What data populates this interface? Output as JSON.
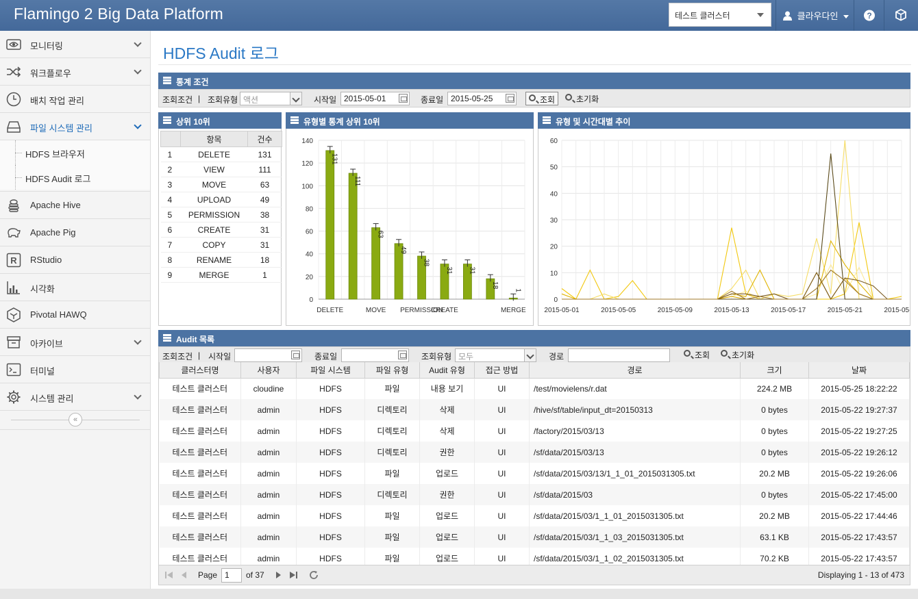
{
  "header": {
    "title": "Flamingo 2 Big Data Platform",
    "cluster": "테스트 클러스터",
    "user": "클라우다인"
  },
  "sidebar": {
    "items": [
      {
        "label": "모니터링"
      },
      {
        "label": "워크플로우"
      },
      {
        "label": "배치 작업 관리"
      },
      {
        "label": "파일 시스템 관리"
      },
      {
        "label": "Apache Hive"
      },
      {
        "label": "Apache Pig"
      },
      {
        "label": "RStudio"
      },
      {
        "label": "시각화"
      },
      {
        "label": "Pivotal HAWQ"
      },
      {
        "label": "아카이브"
      },
      {
        "label": "터미널"
      },
      {
        "label": "시스템 관리"
      }
    ],
    "sub_items": [
      {
        "label": "HDFS 브라우저"
      },
      {
        "label": "HDFS Audit 로그"
      }
    ]
  },
  "page": {
    "title": "HDFS Audit 로그"
  },
  "stats": {
    "header": "통계 조건",
    "condition_label": "조회조건",
    "sep": "|",
    "type_label": "조회유형",
    "type_value": "액션",
    "start_label": "시작일",
    "start_value": "2015-05-01",
    "end_label": "종료일",
    "end_value": "2015-05-25",
    "search": "조회",
    "reset": "초기화"
  },
  "top10": {
    "header": "상위 10위",
    "col_item": "항목",
    "col_count": "건수",
    "rows": [
      {
        "rank": "1",
        "item": "DELETE",
        "count": "131"
      },
      {
        "rank": "2",
        "item": "VIEW",
        "count": "111"
      },
      {
        "rank": "3",
        "item": "MOVE",
        "count": "63"
      },
      {
        "rank": "4",
        "item": "UPLOAD",
        "count": "49"
      },
      {
        "rank": "5",
        "item": "PERMISSION",
        "count": "38"
      },
      {
        "rank": "6",
        "item": "CREATE",
        "count": "31"
      },
      {
        "rank": "7",
        "item": "COPY",
        "count": "31"
      },
      {
        "rank": "8",
        "item": "RENAME",
        "count": "18"
      },
      {
        "rank": "9",
        "item": "MERGE",
        "count": "1"
      }
    ]
  },
  "bar_panel": {
    "header": "유형별 통계 상위 10위"
  },
  "line_panel": {
    "header": "유형 및 시간대별 추이"
  },
  "chart_data": [
    {
      "type": "bar",
      "categories": [
        "DELETE",
        "VIEW",
        "MOVE",
        "UPLOAD",
        "PERMISSION",
        "CREATE",
        "COPY",
        "RENAME",
        "MERGE"
      ],
      "tick_labels": [
        "DELETE",
        "MOVE",
        "PERMISSION",
        "CREATE",
        "MERGE"
      ],
      "values": [
        131,
        111,
        63,
        49,
        38,
        31,
        31,
        18,
        1
      ],
      "ylim": [
        0,
        140
      ],
      "yticks": [
        0,
        20,
        40,
        60,
        80,
        100,
        120,
        140
      ],
      "color": "#8aaa12",
      "grid": true
    },
    {
      "type": "line",
      "x": [
        "2015-05-01",
        "2015-05-02",
        "2015-05-03",
        "2015-05-04",
        "2015-05-05",
        "2015-05-06",
        "2015-05-07",
        "2015-05-08",
        "2015-05-09",
        "2015-05-10",
        "2015-05-11",
        "2015-05-12",
        "2015-05-13",
        "2015-05-14",
        "2015-05-15",
        "2015-05-16",
        "2015-05-17",
        "2015-05-18",
        "2015-05-19",
        "2015-05-20",
        "2015-05-21",
        "2015-05-22",
        "2015-05-23",
        "2015-05-24",
        "2015-05-25"
      ],
      "xticks": [
        "2015-05-01",
        "2015-05-05",
        "2015-05-09",
        "2015-05-13",
        "2015-05-17",
        "2015-05-21",
        "2015-05-25"
      ],
      "ylim": [
        0,
        60
      ],
      "yticks": [
        0,
        10,
        20,
        30,
        40,
        50,
        60
      ],
      "grid": true,
      "series": [
        {
          "color": "#f2c80f",
          "values": [
            4,
            0,
            11,
            0,
            1,
            7,
            0,
            0,
            0,
            0,
            0,
            0,
            27,
            2,
            0,
            0,
            0,
            0,
            0,
            0,
            2,
            29,
            0,
            0,
            1
          ]
        },
        {
          "color": "#f6dd66",
          "values": [
            0,
            0,
            0,
            2,
            0,
            0,
            0,
            0,
            0,
            0,
            0,
            0,
            4,
            11,
            0,
            2,
            1,
            2,
            23,
            2,
            60,
            0,
            0,
            0,
            0
          ]
        },
        {
          "color": "#e0b400",
          "values": [
            2,
            0,
            0,
            0,
            0,
            0,
            0,
            0,
            0,
            0,
            0,
            0,
            2,
            1,
            11,
            0,
            0,
            0,
            0,
            22,
            13,
            6,
            0,
            0,
            0
          ]
        },
        {
          "color": "#fbe99a",
          "values": [
            0,
            0,
            0,
            0,
            0,
            0,
            0,
            0,
            0,
            0,
            0,
            0,
            1,
            3,
            0,
            0,
            0,
            0,
            2,
            13,
            2,
            12,
            0,
            0,
            0
          ]
        },
        {
          "color": "#d9a800",
          "values": [
            0,
            0,
            0,
            0,
            0,
            0,
            0,
            0,
            0,
            0,
            0,
            0,
            1,
            0,
            0,
            0,
            0,
            0,
            10,
            0,
            8,
            2,
            0,
            0,
            0
          ]
        },
        {
          "color": "#5a4a1a",
          "values": [
            0,
            0,
            0,
            0,
            0,
            0,
            0,
            0,
            0,
            0,
            0,
            0,
            0,
            0,
            0,
            0,
            0,
            0,
            0,
            55,
            0,
            0,
            0,
            0,
            0
          ]
        },
        {
          "color": "#7a5a20",
          "values": [
            0,
            0,
            0,
            0,
            0,
            0,
            0,
            0,
            0,
            0,
            0,
            0,
            2,
            2,
            1,
            2,
            0,
            0,
            10,
            0,
            8,
            7,
            5,
            0,
            0
          ]
        },
        {
          "color": "#a07a2a",
          "values": [
            0,
            0,
            0,
            0,
            0,
            0,
            0,
            0,
            0,
            0,
            0,
            0,
            3,
            0,
            1,
            0,
            0,
            0,
            4,
            11,
            7,
            2,
            0,
            0,
            0
          ]
        }
      ]
    }
  ],
  "audit": {
    "header": "Audit 목록",
    "condition_label": "조회조건",
    "sep": "|",
    "start_label": "시작일",
    "end_label": "종료일",
    "type_label": "조회유형",
    "type_value": "모두",
    "path_label": "경로",
    "search": "조회",
    "reset": "초기화",
    "columns": [
      "클러스터명",
      "사용자",
      "파일 시스템",
      "파일 유형",
      "Audit 유형",
      "접근 방법",
      "경로",
      "크기",
      "날짜"
    ],
    "rows": [
      [
        "테스트 클러스터",
        "cloudine",
        "HDFS",
        "파일",
        "내용 보기",
        "UI",
        "/test/movielens/r.dat",
        "224.2 MB",
        "2015-05-25 18:22:22"
      ],
      [
        "테스트 클러스터",
        "admin",
        "HDFS",
        "디렉토리",
        "삭제",
        "UI",
        "/hive/sf/table/input_dt=20150313",
        "0 bytes",
        "2015-05-22 19:27:37"
      ],
      [
        "테스트 클러스터",
        "admin",
        "HDFS",
        "디렉토리",
        "삭제",
        "UI",
        "/factory/2015/03/13",
        "0 bytes",
        "2015-05-22 19:27:25"
      ],
      [
        "테스트 클러스터",
        "admin",
        "HDFS",
        "디렉토리",
        "권한",
        "UI",
        "/sf/data/2015/03/13",
        "0 bytes",
        "2015-05-22 19:26:12"
      ],
      [
        "테스트 클러스터",
        "admin",
        "HDFS",
        "파일",
        "업로드",
        "UI",
        "/sf/data/2015/03/13/1_1_01_2015031305.txt",
        "20.2 MB",
        "2015-05-22 19:26:06"
      ],
      [
        "테스트 클러스터",
        "admin",
        "HDFS",
        "디렉토리",
        "권한",
        "UI",
        "/sf/data/2015/03",
        "0 bytes",
        "2015-05-22 17:45:00"
      ],
      [
        "테스트 클러스터",
        "admin",
        "HDFS",
        "파일",
        "업로드",
        "UI",
        "/sf/data/2015/03/1_1_01_2015031305.txt",
        "20.2 MB",
        "2015-05-22 17:44:46"
      ],
      [
        "테스트 클러스터",
        "admin",
        "HDFS",
        "파일",
        "업로드",
        "UI",
        "/sf/data/2015/03/1_1_03_2015031305.txt",
        "63.1 KB",
        "2015-05-22 17:43:57"
      ],
      [
        "테스트 클러스터",
        "admin",
        "HDFS",
        "파일",
        "업로드",
        "UI",
        "/sf/data/2015/03/1_1_02_2015031305.txt",
        "70.2 KB",
        "2015-05-22 17:43:57"
      ]
    ]
  },
  "pager": {
    "page_label": "Page",
    "page_value": "1",
    "of_label": "of 37",
    "display": "Displaying 1 - 13 of 473"
  }
}
